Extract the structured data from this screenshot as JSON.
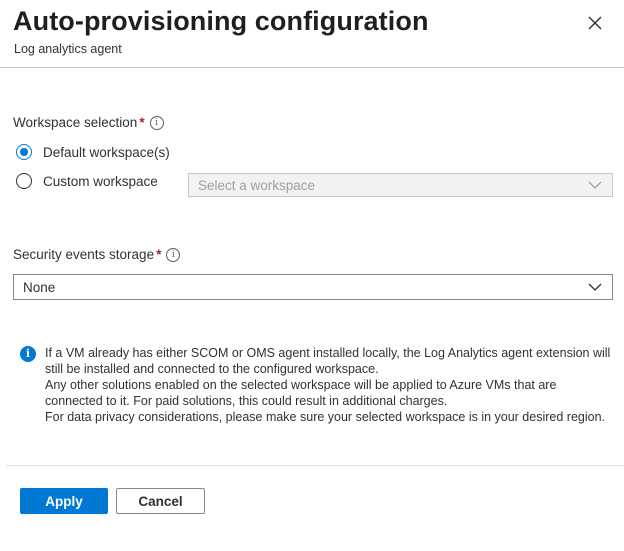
{
  "header": {
    "title": "Auto-provisioning configuration",
    "subtitle": "Log analytics agent",
    "close_icon": "close-icon"
  },
  "workspace_selection": {
    "label": "Workspace selection",
    "required_marker": "*",
    "info_icon": "info-icon",
    "options": [
      {
        "label": "Default workspace(s)",
        "selected": true
      },
      {
        "label": "Custom workspace",
        "selected": false
      }
    ],
    "workspace_dropdown": {
      "placeholder": "Select a workspace",
      "disabled": true,
      "icon": "chevron-down-icon"
    }
  },
  "security_events_storage": {
    "label": "Security events storage",
    "required_marker": "*",
    "info_icon": "info-icon",
    "selected_value": "None",
    "icon": "chevron-down-icon"
  },
  "info_message": {
    "icon": "info-icon",
    "lines": [
      "If a VM already has either SCOM or OMS agent installed locally, the Log Analytics agent extension will still be installed and connected to the configured workspace.",
      "Any other solutions enabled on the selected workspace will be applied to Azure VMs that are connected to it. For paid solutions, this could result in additional charges.",
      "For data privacy considerations, please make sure your selected workspace is in your desired region."
    ]
  },
  "footer": {
    "apply_label": "Apply",
    "cancel_label": "Cancel"
  },
  "colors": {
    "accent": "#0078d4",
    "required": "#a4262c",
    "text": "#323130",
    "border": "#8a8886",
    "disabled_bg": "#f3f2f1"
  }
}
